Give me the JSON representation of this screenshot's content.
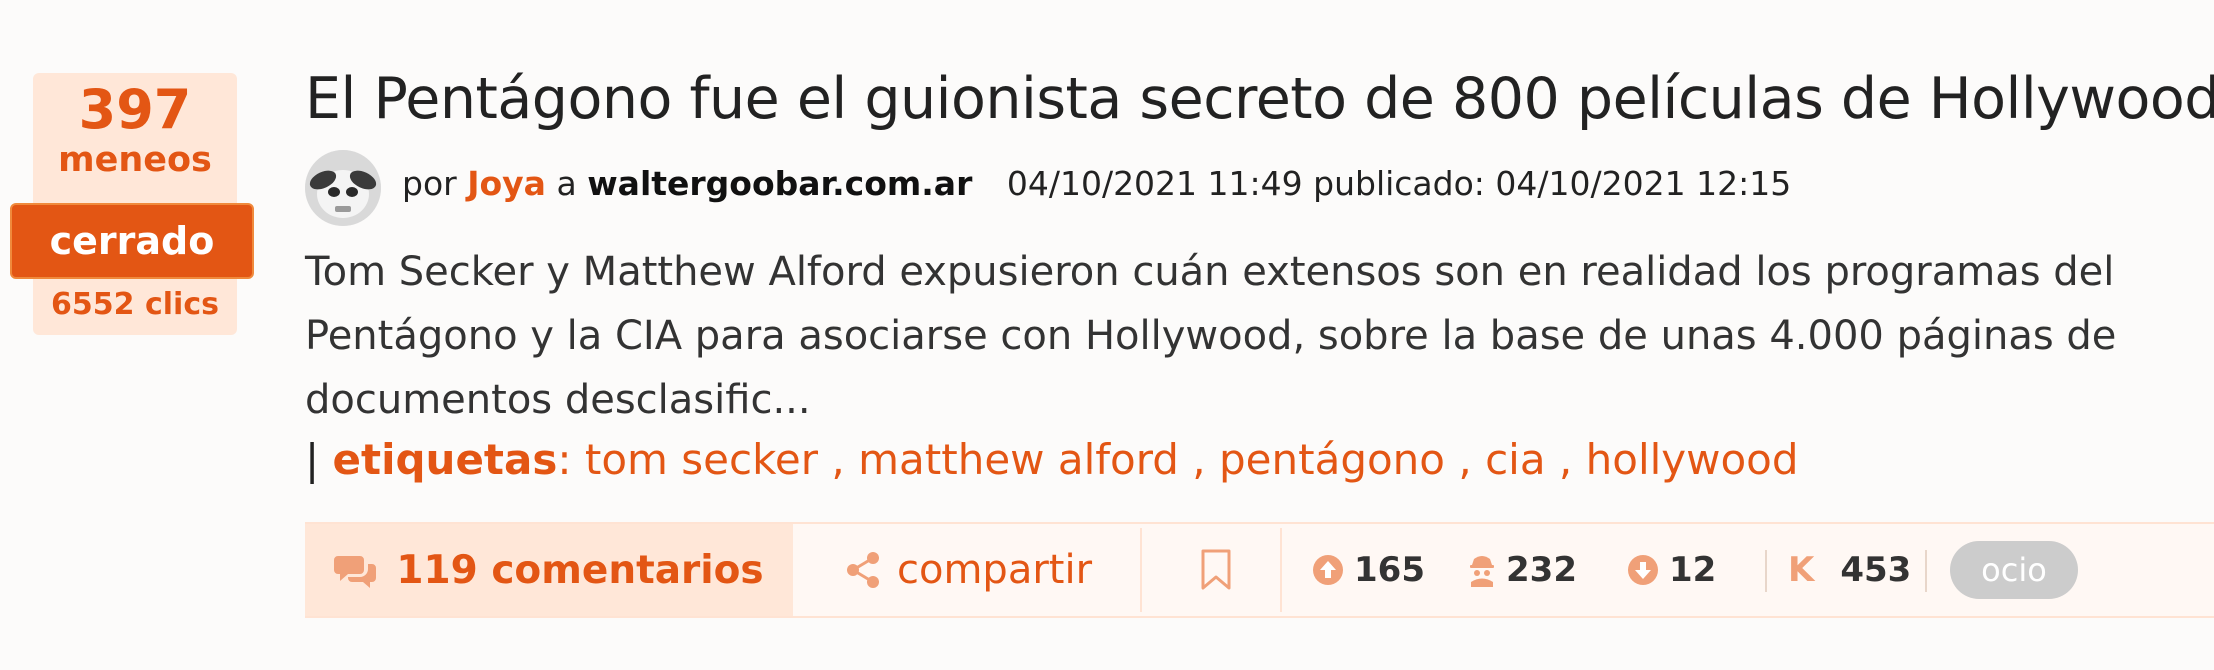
{
  "vote": {
    "count": "397",
    "label": "meneos",
    "status": "cerrado",
    "clicks": "6552 clics"
  },
  "story": {
    "title": "El Pentágono fue el guionista secreto de 800 películas de Hollywood",
    "by_prefix": "por",
    "author": "Joya",
    "at_word": "a",
    "domain": "waltergoobar.com.ar",
    "sent_date": "04/10/2021 11:49",
    "published_label": "publicado:",
    "published_date": "04/10/2021 12:15",
    "summary": "Tom Secker y Matthew Alford expusieron cuán extensos son en realidad los programas del Pentágono y la CIA para asociarse con Hollywood, sobre la base de unas 4.000 páginas de documentos desclasific...",
    "tags_label": "etiquetas",
    "tags": [
      "tom secker",
      "matthew alford",
      "pentágono",
      "cia",
      "hollywood"
    ]
  },
  "toolbar": {
    "comments": "119 comentarios",
    "share": "compartir",
    "votes_up": "165",
    "votes_anon": "232",
    "votes_down": "12",
    "karma_letter": "K",
    "karma": "453",
    "sub": "ocio"
  },
  "colors": {
    "accent": "#e35614",
    "accent_light": "#ffe7d8",
    "pill_gray": "#cccccc"
  },
  "icons": [
    "comments-icon",
    "share-icon",
    "bookmark-icon",
    "arrow-up-circle-icon",
    "anonymous-icon",
    "arrow-down-circle-icon",
    "karma-icon"
  ]
}
